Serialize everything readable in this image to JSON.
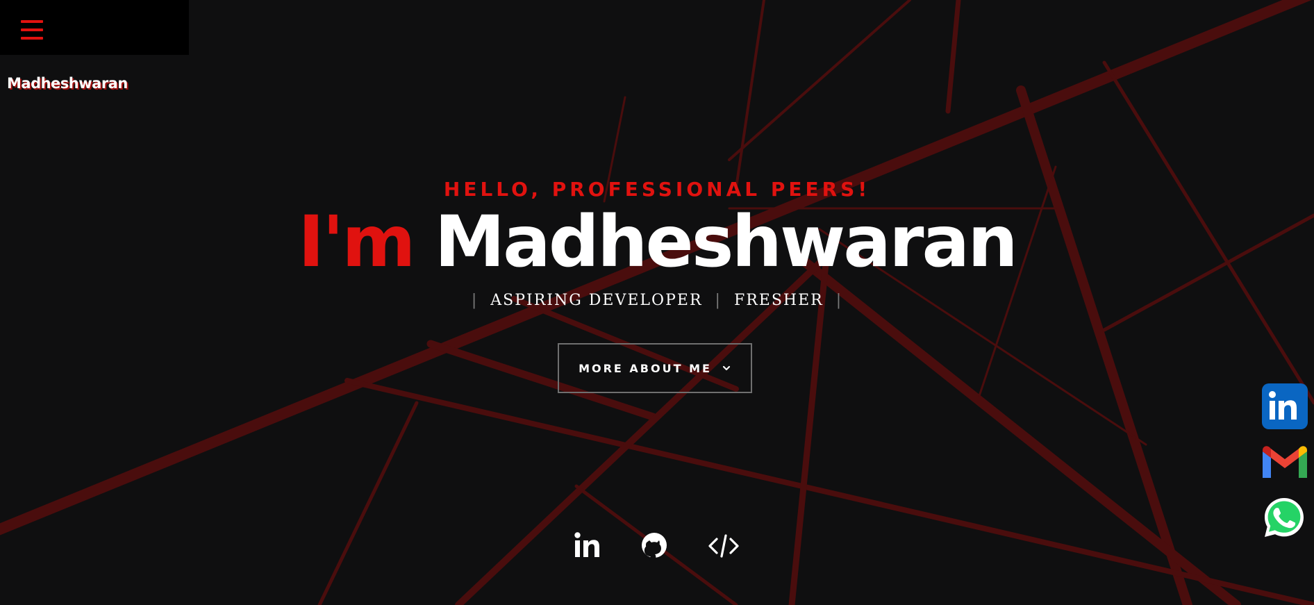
{
  "nav": {
    "menu_icon": "hamburger-menu-icon",
    "brand": "Madheshwaran"
  },
  "hero": {
    "greeting": "HELLO, PROFESSIONAL PEERS!",
    "im": "I'm",
    "name": "Madheshwaran",
    "role_separator": "|",
    "roles": [
      "ASPIRING DEVELOPER",
      "FRESHER"
    ],
    "cta_label": "MORE ABOUT ME",
    "cta_icon": "chevron-down-icon"
  },
  "social_bottom": [
    {
      "icon": "linkedin-icon"
    },
    {
      "icon": "github-icon"
    },
    {
      "icon": "code-icon"
    }
  ],
  "side_contacts": [
    {
      "icon": "linkedin-icon"
    },
    {
      "icon": "gmail-icon"
    },
    {
      "icon": "whatsapp-icon"
    }
  ],
  "colors": {
    "background": "#0f0f10",
    "accent": "#e0120f",
    "lines": "#4a0d0d",
    "text": "#ffffff",
    "linkedin": "#0a66c2",
    "whatsapp": "#25d366"
  }
}
